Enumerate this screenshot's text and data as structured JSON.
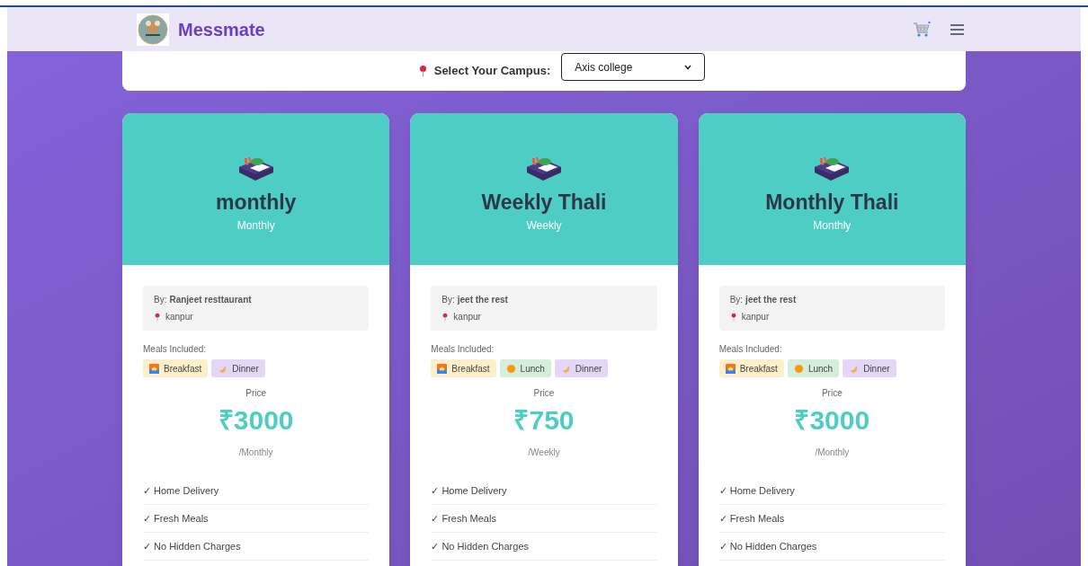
{
  "header": {
    "brand": "Messmate"
  },
  "campus": {
    "label": "Select Your Campus:",
    "value": "Axis college"
  },
  "plans": [
    {
      "title": "monthly",
      "period": "Monthly",
      "by_label": "By:",
      "vendor": "Ranjeet resttaurant",
      "location": "kanpur",
      "meals_label": "Meals Included:",
      "meals": [
        {
          "kind": "breakfast",
          "label": "Breakfast"
        },
        {
          "kind": "dinner",
          "label": "Dinner"
        }
      ],
      "price_label": "Price",
      "price": "₹3000",
      "per": "/Monthly",
      "features": [
        "✓ Home Delivery",
        "✓ Fresh Meals",
        "✓ No Hidden Charges"
      ]
    },
    {
      "title": "Weekly Thali",
      "period": "Weekly",
      "by_label": "By:",
      "vendor": "jeet the rest",
      "location": "kanpur",
      "meals_label": "Meals Included:",
      "meals": [
        {
          "kind": "breakfast",
          "label": "Breakfast"
        },
        {
          "kind": "lunch",
          "label": "Lunch"
        },
        {
          "kind": "dinner",
          "label": "Dinner"
        }
      ],
      "price_label": "Price",
      "price": "₹750",
      "per": "/Weekly",
      "features": [
        "✓ Home Delivery",
        "✓ Fresh Meals",
        "✓ No Hidden Charges"
      ]
    },
    {
      "title": "Monthly Thali",
      "period": "Monthly",
      "by_label": "By:",
      "vendor": "jeet the rest",
      "location": "kanpur",
      "meals_label": "Meals Included:",
      "meals": [
        {
          "kind": "breakfast",
          "label": "Breakfast"
        },
        {
          "kind": "lunch",
          "label": "Lunch"
        },
        {
          "kind": "dinner",
          "label": "Dinner"
        }
      ],
      "price_label": "Price",
      "price": "₹3000",
      "per": "/Monthly",
      "features": [
        "✓ Home Delivery",
        "✓ Fresh Meals",
        "✓ No Hidden Charges"
      ]
    }
  ]
}
